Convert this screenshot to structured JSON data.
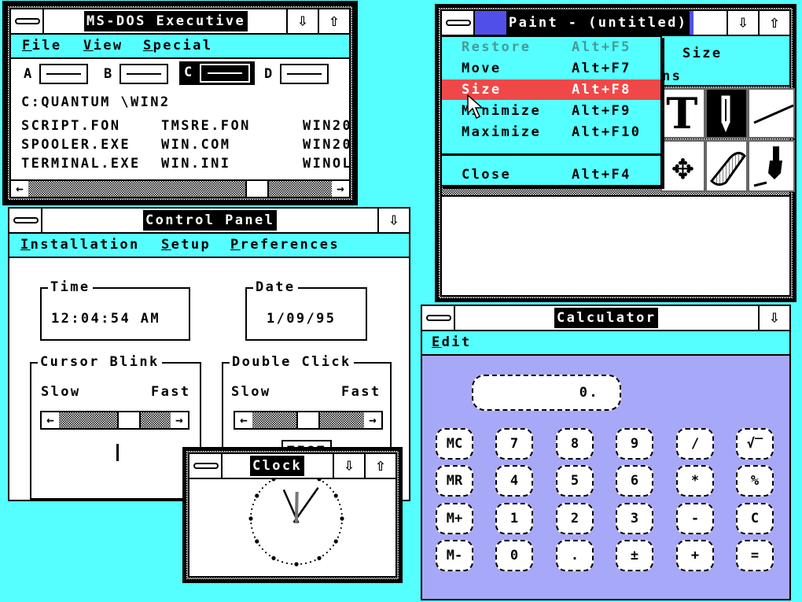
{
  "msdos": {
    "title": "MS-DOS Executive",
    "menu": [
      "File",
      "View",
      "Special"
    ],
    "drives": [
      "A",
      "B",
      "C",
      "D"
    ],
    "selected_drive": "C",
    "path": "C:QUANTUM \\WIN2",
    "files": [
      [
        "SCRIPT.FON",
        "TMSRE.FON",
        "WIN20"
      ],
      [
        "SPOOLER.EXE",
        "WIN.COM",
        "WIN20"
      ],
      [
        "TERMINAL.EXE",
        "WIN.INI",
        "WINOL"
      ]
    ],
    "scroll_left": "←",
    "scroll_right": "→",
    "minimize": "⇩",
    "maximize": "⇧"
  },
  "paint": {
    "title": "Paint - (untitled)",
    "menu_visible": [
      "Size",
      "ns"
    ],
    "minimize": "⇩",
    "maximize": "⇧",
    "tools": [
      "text-tool",
      "pencil-tool",
      "line-tool",
      "move-tool",
      "eraser-tool",
      "brush-tool"
    ],
    "text_tool_glyph": "T",
    "move_glyph": "✥",
    "system_menu": [
      {
        "label": "Restore",
        "shortcut": "Alt+F5",
        "disabled": true
      },
      {
        "label": "Move",
        "shortcut": "Alt+F7"
      },
      {
        "label": "Size",
        "shortcut": "Alt+F8",
        "highlighted": true
      },
      {
        "label": "Minimize",
        "shortcut": "Alt+F9"
      },
      {
        "label": "Maximize",
        "shortcut": "Alt+F10"
      },
      {
        "label": "Close",
        "shortcut": "Alt+F4"
      }
    ]
  },
  "control": {
    "title": "Control Panel",
    "menu": [
      "Installation",
      "Setup",
      "Preferences"
    ],
    "minimize": "⇩",
    "time_label": "Time",
    "time": "12:04:54 AM",
    "date_label": "Date",
    "date": "1/09/95",
    "blink_label": "Cursor Blink",
    "dbl_label": "Double Click",
    "slow": "Slow",
    "fast": "Fast",
    "test": "TEST",
    "arrow_left": "←",
    "arrow_right": "→"
  },
  "clock": {
    "title": "Clock",
    "minimize": "⇩",
    "maximize": "⇧",
    "time": "12:04:54"
  },
  "calc": {
    "title": "Calculator",
    "menu": [
      "Edit"
    ],
    "minimize": "⇩",
    "display": "0.",
    "buttons": [
      [
        "MC",
        "7",
        "8",
        "9",
        "/",
        "√‾"
      ],
      [
        "MR",
        "4",
        "5",
        "6",
        "*",
        "%"
      ],
      [
        "M+",
        "1",
        "2",
        "3",
        "-",
        "C"
      ],
      [
        "M-",
        "0",
        ".",
        "±",
        "+",
        "="
      ]
    ]
  },
  "colors": {
    "desktop": "#55ffff",
    "menu": "#55ffff",
    "highlight": "#f04848",
    "calc_body": "#a8a8f8",
    "paint_title_accent": "#5050e8"
  }
}
